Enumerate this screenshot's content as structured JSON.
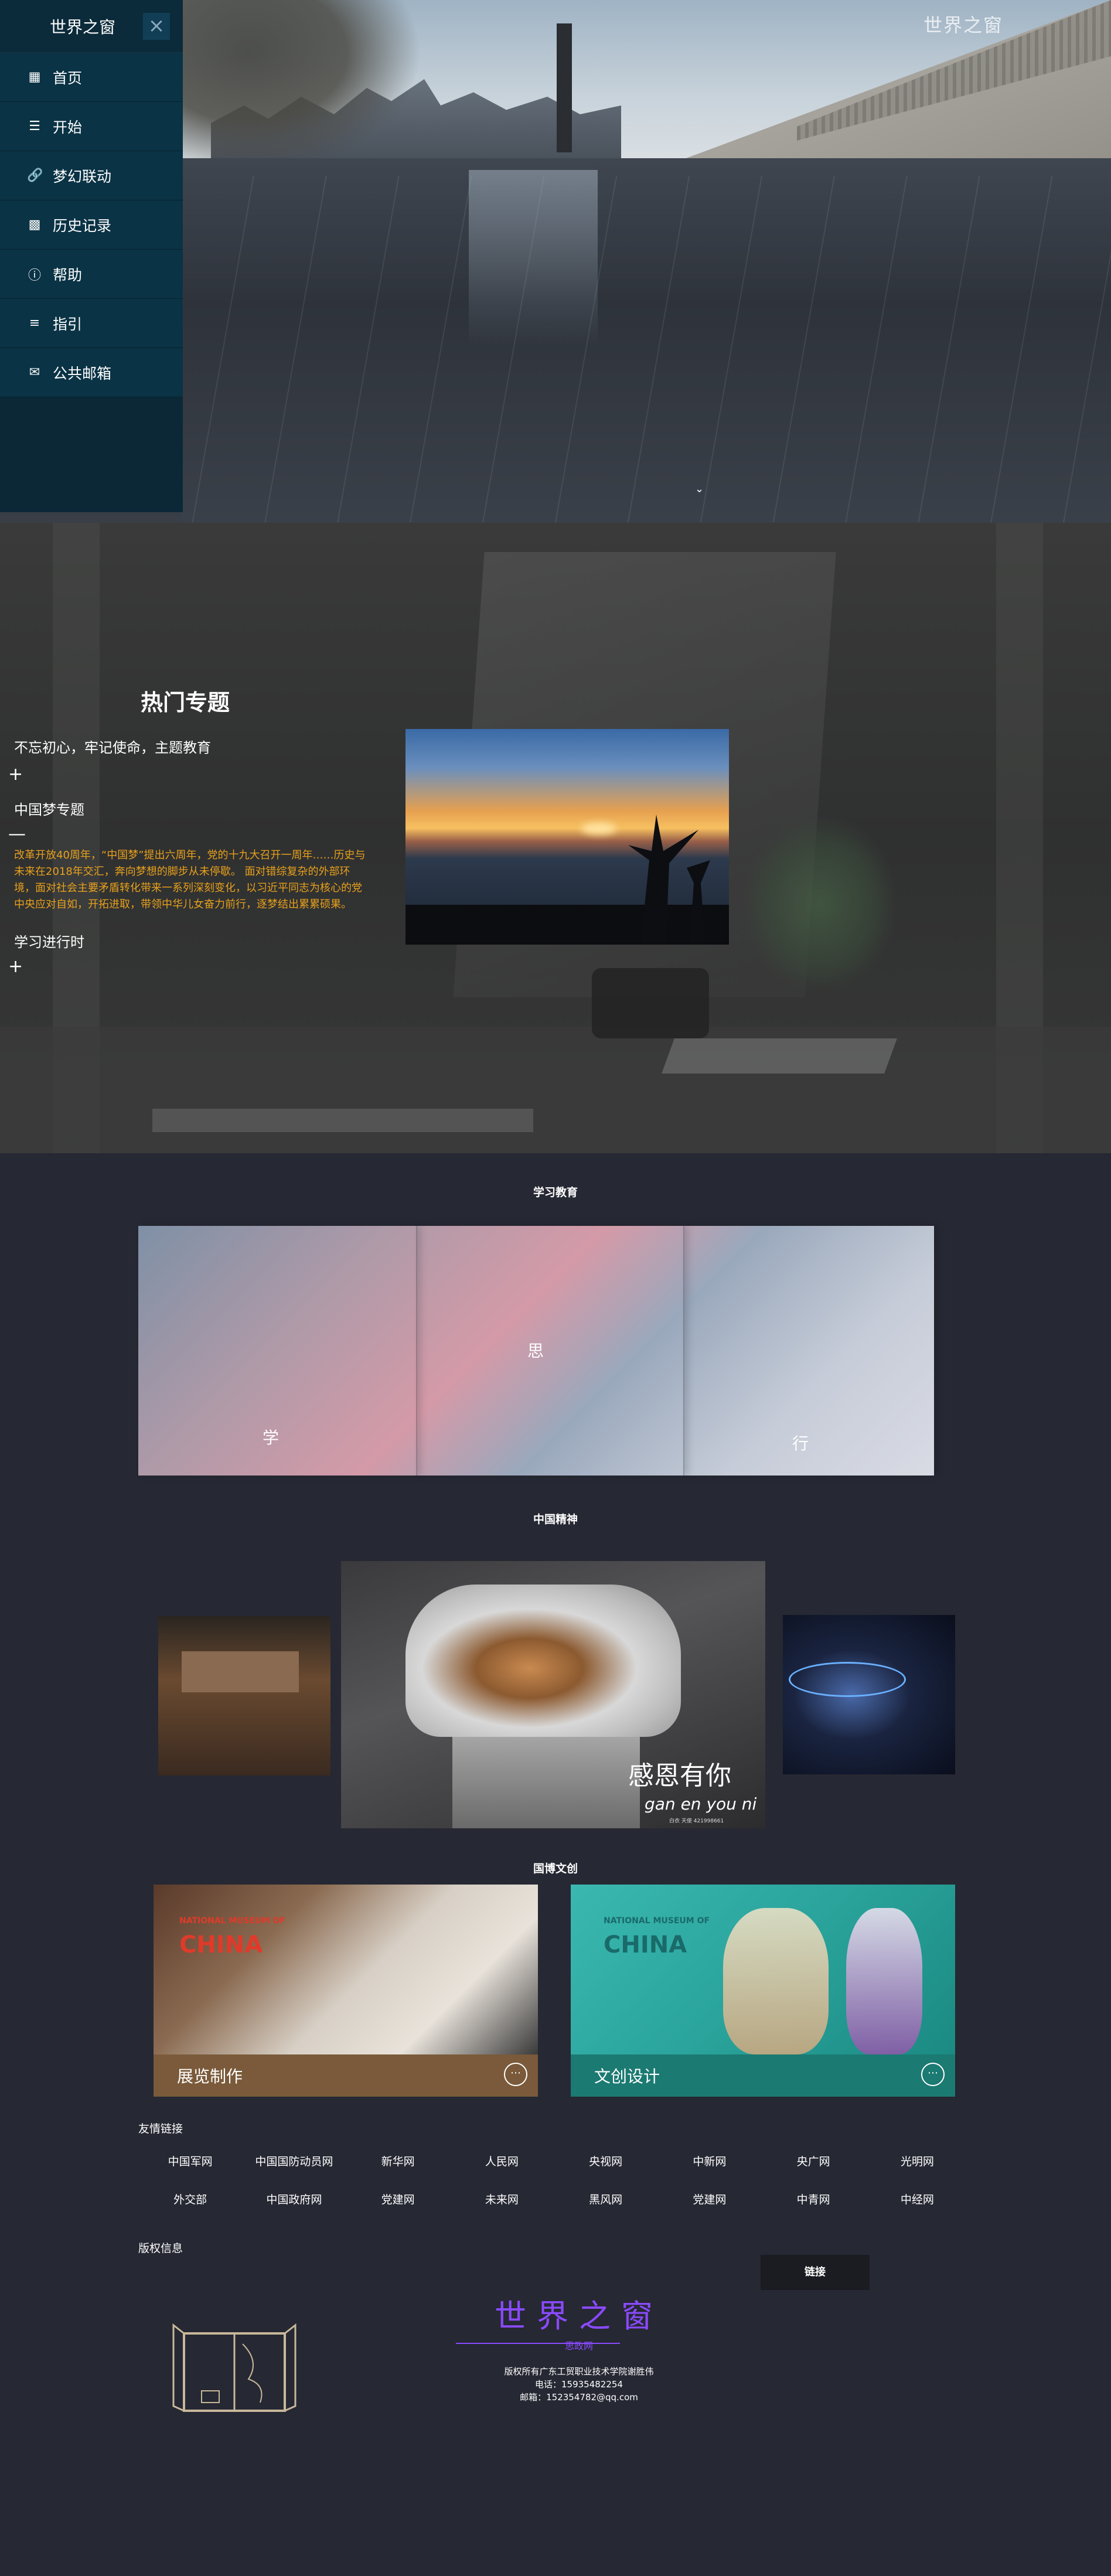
{
  "hero": {
    "watermark": "世界之窗",
    "scroll_icon": "chevron-down"
  },
  "sidebar": {
    "title": "世界之窗",
    "close": "×",
    "items": [
      {
        "label": "首页",
        "icon": "grid-icon"
      },
      {
        "label": "开始",
        "icon": "list-icon"
      },
      {
        "label": "梦幻联动",
        "icon": "link-icon"
      },
      {
        "label": "历史记录",
        "icon": "calendar-icon"
      },
      {
        "label": "帮助",
        "icon": "help-icon"
      },
      {
        "label": "指引",
        "icon": "sliders-icon"
      },
      {
        "label": "公共邮箱",
        "icon": "mail-icon"
      }
    ]
  },
  "topics": {
    "title": "热门专题",
    "item1": "不忘初心，牢记使命，主题教育",
    "item2": "中国梦专题",
    "item2_text": "改革开放40周年，“中国梦”提出六周年，党的十九大召开一周年……历史与未来在2018年交汇，奔向梦想的脚步从未停歇。 面对错综复杂的外部环境，面对社会主要矛盾转化带来一系列深刻变化，以习近平同志为核心的党中央应对自如，开拓进取，带领中华儿女奋力前行，逐梦结出累累硕果。",
    "item3": "学习进行时",
    "plus": "+",
    "minus": "—"
  },
  "learn": {
    "title": "学习教育",
    "labels": [
      "学",
      "思",
      "行"
    ]
  },
  "spirit": {
    "title": "中国精神",
    "poster_title": "感恩有你",
    "poster_pinyin": "gan en you ni",
    "poster_small": "白衣 天使 421998661"
  },
  "culture": {
    "title": "国博文创",
    "cards": [
      {
        "label": "展览制作",
        "museum": "NATIONAL MUSEUM OF",
        "china": "CHINA",
        "bar_color": "#7a5a3a"
      },
      {
        "label": "文创设计",
        "museum": "NATIONAL MUSEUM OF",
        "china": "CHINA",
        "bar_color": "#1b7a72"
      }
    ]
  },
  "links": {
    "title": "友情链接",
    "items": [
      "中国军网",
      "中国国防动员网",
      "新华网",
      "人民网",
      "央视网",
      "中新网",
      "央广网",
      "光明网",
      "外交部",
      "中国政府网",
      "党建网",
      "未来网",
      "黑风网",
      "党建网",
      "中青网",
      "中经网"
    ]
  },
  "footer": {
    "title": "版权信息",
    "button": "链接",
    "brand": "世界之窗",
    "brand_sub": "思政网",
    "copyright": "版权所有广东工贸职业技术学院谢胜伟",
    "phone": "电话：15935482254",
    "email": "邮箱：152354782@qq.com"
  }
}
